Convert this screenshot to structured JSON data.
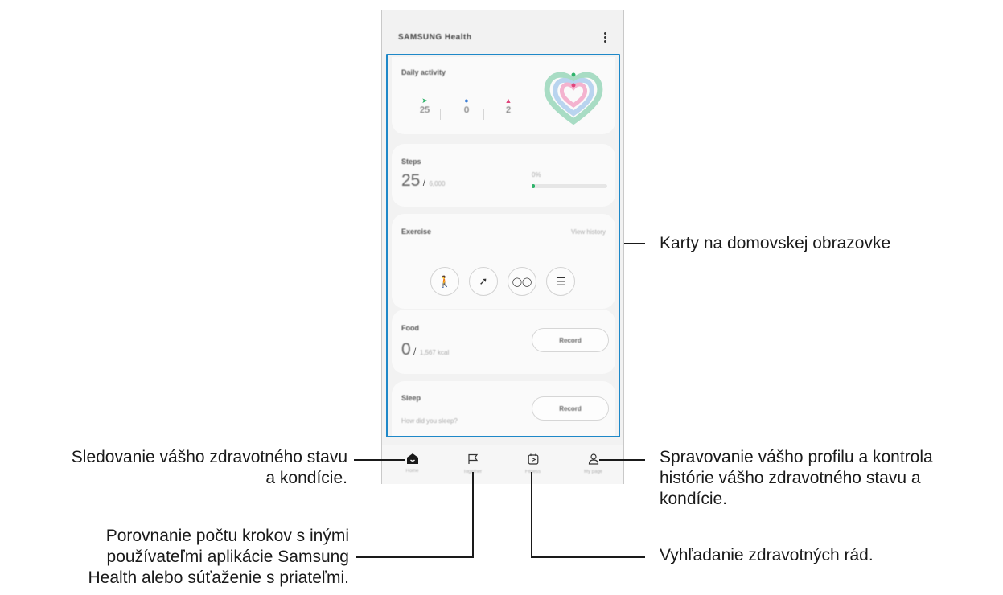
{
  "app": {
    "title": "SAMSUNG Health"
  },
  "daily_activity": {
    "title": "Daily activity",
    "stats": [
      {
        "icon": "shoe-icon",
        "color": "#2fb36b",
        "value": "25"
      },
      {
        "icon": "clock-icon",
        "color": "#3d7fd6",
        "value": "0"
      },
      {
        "icon": "flame-icon",
        "color": "#e0457b",
        "value": "2"
      }
    ],
    "ring_colors": [
      "#a8dcc4",
      "#b9d4ef",
      "#f4b3cf"
    ]
  },
  "steps": {
    "title": "Steps",
    "value": "25",
    "goal": "6,000",
    "percent": "0%",
    "progress_fraction": 0.01
  },
  "exercise": {
    "title": "Exercise",
    "link": "View history",
    "types": [
      "walking-icon",
      "running-icon",
      "cycling-icon",
      "list-icon"
    ]
  },
  "food": {
    "title": "Food",
    "value": "0",
    "goal": "1,567 kcal",
    "button": "Record"
  },
  "sleep": {
    "title": "Sleep",
    "prompt": "How did you sleep?",
    "button": "Record"
  },
  "nav": [
    {
      "label": "Home",
      "icon": "home-icon"
    },
    {
      "label": "Together",
      "icon": "flag-icon"
    },
    {
      "label": "Fitness",
      "icon": "play-calendar-icon"
    },
    {
      "label": "My page",
      "icon": "person-icon"
    }
  ],
  "annotations": {
    "cards": "Karty na domovskej obrazovke",
    "home_line1": "Sledovanie vášho zdravotného stavu",
    "home_line2": "a kondície.",
    "together_line1": "Porovnanie počtu krokov s inými",
    "together_line2": "používateľmi aplikácie Samsung",
    "together_line3": "Health alebo súťaženie s priateľmi.",
    "mypage_line1": "Spravovanie vášho profilu a kontrola",
    "mypage_line2": "histórie vášho zdravotného stavu a",
    "mypage_line3": "kondície.",
    "fitness": "Vyhľadanie zdravotných rád."
  },
  "colors": {
    "highlight": "#1e88c8",
    "accent_green": "#2fb36b"
  }
}
